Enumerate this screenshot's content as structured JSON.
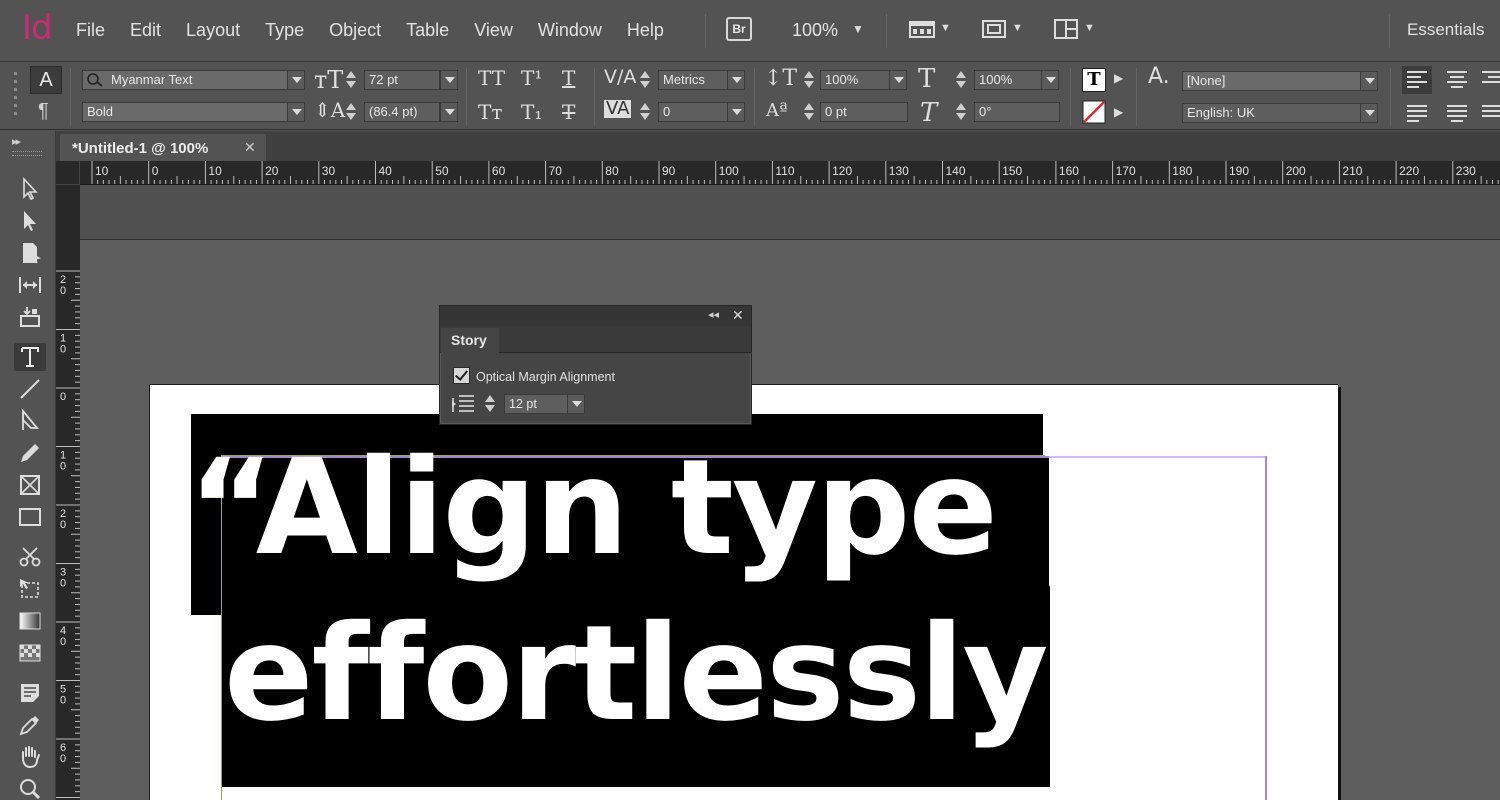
{
  "app": {
    "logo": "Id"
  },
  "menu": [
    "File",
    "Edit",
    "Layout",
    "Type",
    "Object",
    "Table",
    "View",
    "Window",
    "Help"
  ],
  "menubar": {
    "bridge_label": "Br",
    "zoom": "100%",
    "workspace": "Essentials"
  },
  "control_panel": {
    "font_family": "Myanmar Text",
    "font_style": "Bold",
    "font_size": "72 pt",
    "leading": "(86.4 pt)",
    "kerning": "Metrics",
    "tracking": "0",
    "vertical_scale": "100%",
    "horizontal_scale": "100%",
    "baseline_shift": "0 pt",
    "skew": "0°",
    "character_style": "[None]",
    "language": "English: UK",
    "char_mode": "A",
    "para_mode": "¶"
  },
  "document": {
    "tab_title": "*Untitled-1 @ 100%",
    "tab_close": "✕",
    "headline_line1": "“Align type",
    "headline_line2": "effortlessly”"
  },
  "ruler": {
    "horizontal": [
      "10",
      "0",
      "10",
      "20",
      "30",
      "40",
      "50",
      "60",
      "70",
      "80",
      "90",
      "100",
      "110",
      "120",
      "130",
      "140",
      "150",
      "160",
      "170",
      "180",
      "190",
      "200",
      "210",
      "220",
      "230"
    ],
    "vertical": [
      "2\n0",
      "1\n0",
      "0",
      "1\n0",
      "2\n0",
      "3\n0",
      "4\n0",
      "5\n0",
      "6\n0",
      "7\n0"
    ]
  },
  "story_panel": {
    "tab_label": "Story",
    "collapse": "◂◂",
    "close": "✕",
    "optical_margin_label": "Optical Margin Alignment",
    "optical_margin_checked": true,
    "size_value": "12 pt"
  },
  "colors": {
    "logo": "#cc2a74",
    "ui_bg": "#535353",
    "canvas": "#5e5e5e",
    "frame_edge": "#9aa64a",
    "margin_guide": "#9c87e8"
  }
}
